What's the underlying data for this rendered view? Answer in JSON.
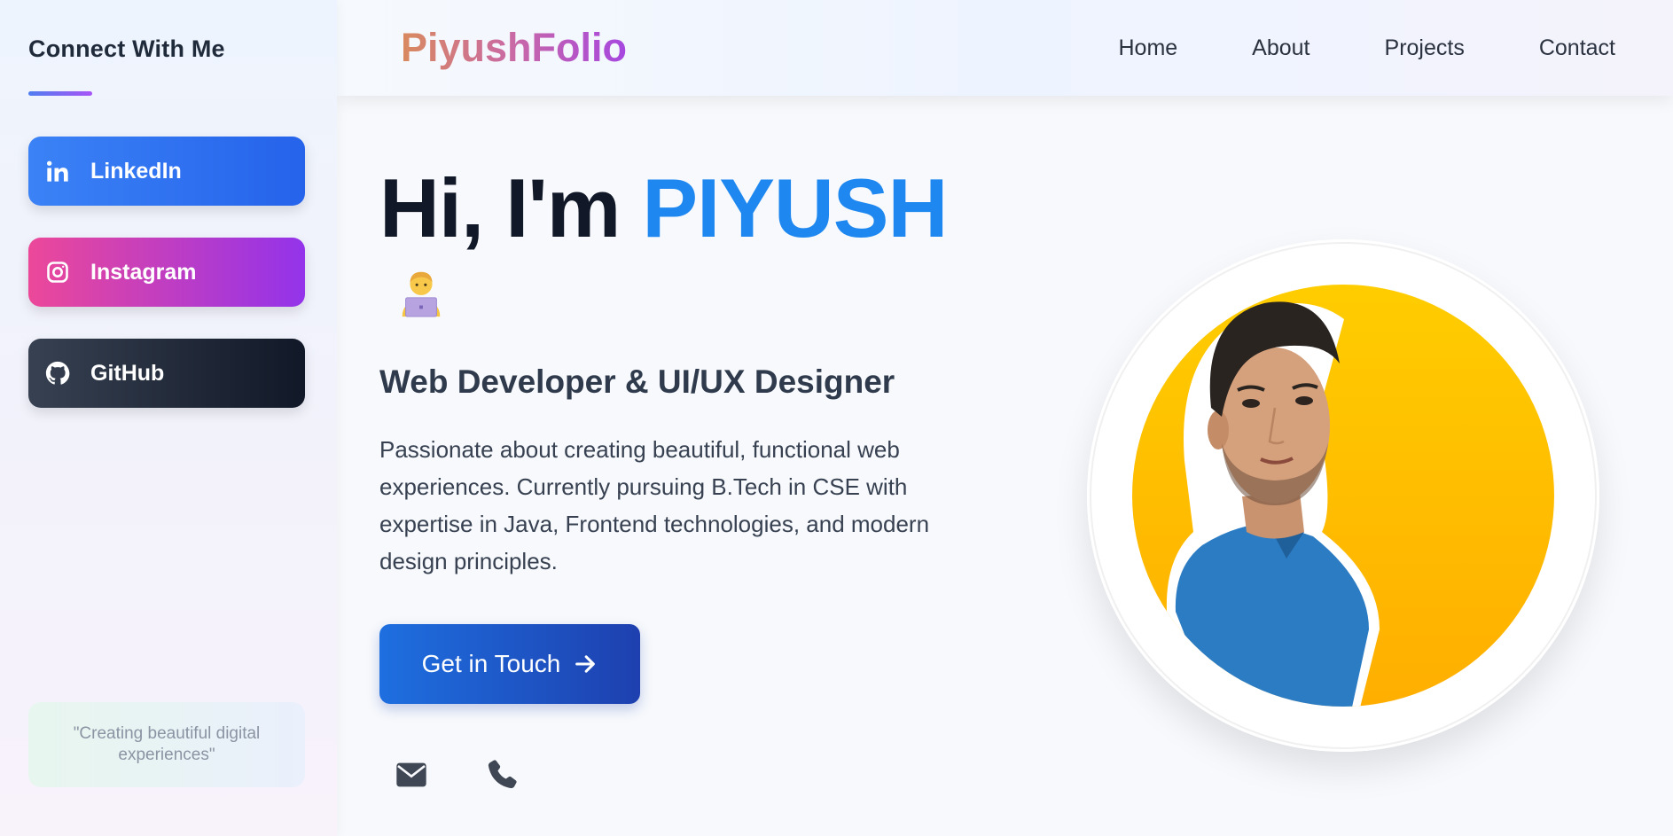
{
  "sidebar": {
    "title": "Connect With Me",
    "socials": [
      {
        "label": "LinkedIn",
        "icon": "linkedin-icon"
      },
      {
        "label": "Instagram",
        "icon": "instagram-icon"
      },
      {
        "label": "GitHub",
        "icon": "github-icon"
      }
    ],
    "quote": "\"Creating beautiful digital experiences\""
  },
  "header": {
    "logo": "PiyushFolio",
    "nav": [
      "Home",
      "About",
      "Projects",
      "Contact"
    ]
  },
  "hero": {
    "greeting_prefix": "Hi, I'm ",
    "name": "PIYUSH",
    "emoji": "🧑‍💻",
    "subtitle": "Web Developer & UI/UX Designer",
    "description": "Passionate about creating beautiful, functional web experiences. Currently pursuing B.Tech in CSE with expertise in Java, Frontend technologies, and modern design principles.",
    "cta_label": "Get in Touch",
    "contact_icons": [
      "envelope-icon",
      "phone-icon"
    ]
  },
  "colors": {
    "accent": "#1e88f0",
    "cta": "#1e40af",
    "profile_bg": "#ffc107"
  }
}
